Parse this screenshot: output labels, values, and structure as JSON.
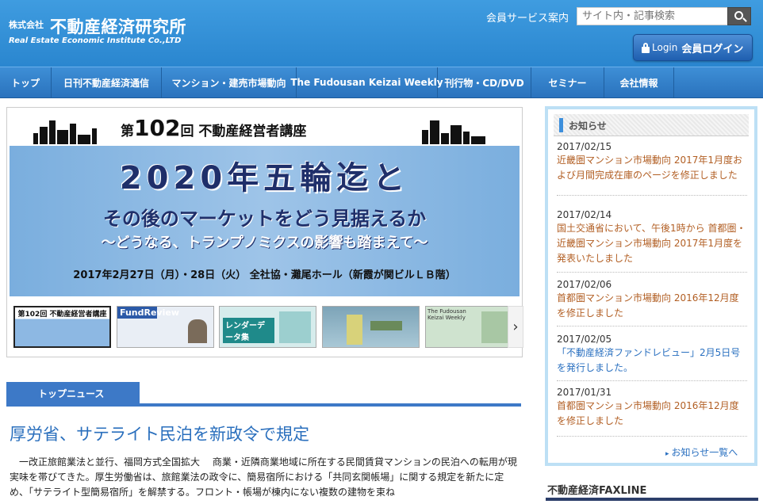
{
  "header": {
    "company_prefix": "株式会社",
    "company_name": "不動産経済研究所",
    "company_en": "Real Estate Economic Institute Co.,LTD",
    "member_link": "会員サービス案内",
    "search_placeholder": "サイト内・記事検索",
    "login_label": "Login",
    "login_label_ja": "会員ログイン"
  },
  "nav": {
    "items": [
      {
        "label": "トップ"
      },
      {
        "label": "日刊不動産経済通信"
      },
      {
        "label": "マンション・建売市場動向"
      },
      {
        "label": "The Fudousan Keizai Weekly"
      },
      {
        "label": "刊行物・CD/DVD"
      },
      {
        "label": "セミナー"
      },
      {
        "label": "会社情報"
      }
    ]
  },
  "banner": {
    "title_prefix": "第",
    "title_number": "102",
    "title_suffix": "回 不動産経営者講座",
    "headline": "2020年五輪迄と",
    "subheadline": "その後のマーケットをどう見据えるか",
    "subheadline2": "～どうなる、トランプノミクスの影響も踏まえて～",
    "date_line": "2017年2月27日（月）・28日（火） 全社協・灘尾ホール（新霞が関ビルＬＢ階）",
    "thumbs": [
      {
        "label": "第102回 不動産経営者講座"
      },
      {
        "label": "FundReview"
      },
      {
        "label": "レンダーデータ集"
      },
      {
        "label": ""
      },
      {
        "label": "The Fudousan Keizai Weekly"
      }
    ],
    "next_arrow": "›"
  },
  "topnews": {
    "tab_label": "トップニュース",
    "article_title": "厚労省、サテライト民泊を新政令で規定",
    "article_body": "　一改正旅館業法と並行、福岡方式全国拡大　 商業・近隣商業地域に所在する民間賃貸マンションの民泊への転用が現実味を帯びてきた。厚生労働省は、旅館業法の政令に、簡易宿所における「共同玄関帳場」に関する規定を新たに定め、「サテライト型簡易宿所」を解禁する。フロント・帳場が棟内にない複数の建物を束ね"
  },
  "sidebar": {
    "title": "お知らせ",
    "items": [
      {
        "date": "2017/02/15",
        "text": "近畿圏マンション市場動向 2017年1月度および月間完成在庫のページを修正しました"
      },
      {
        "date": "2017/02/14",
        "text": "国土交通省において、午後1時から 首都圏・近畿圏マンション市場動向 2017年1月度を発表いたしました"
      },
      {
        "date": "2017/02/06",
        "text": "首都圏マンション市場動向 2016年12月度を修正しました"
      },
      {
        "date": "2017/02/05",
        "text": "「不動産経済ファンドレビュー」2月5日号を発行しました。"
      },
      {
        "date": "2017/01/31",
        "text": "首都圏マンション市場動向 2016年12月度を修正しました"
      }
    ],
    "more_label": "お知らせ一覧へ"
  },
  "fax": {
    "title": "不動産経済FAXLINE"
  },
  "colors": {
    "header_blue": "#2a86cf",
    "nav_blue": "#3e8fd6",
    "accent_blue": "#3d79c7",
    "link_orange": "#b25f24",
    "link_blue": "#2a70c0"
  }
}
